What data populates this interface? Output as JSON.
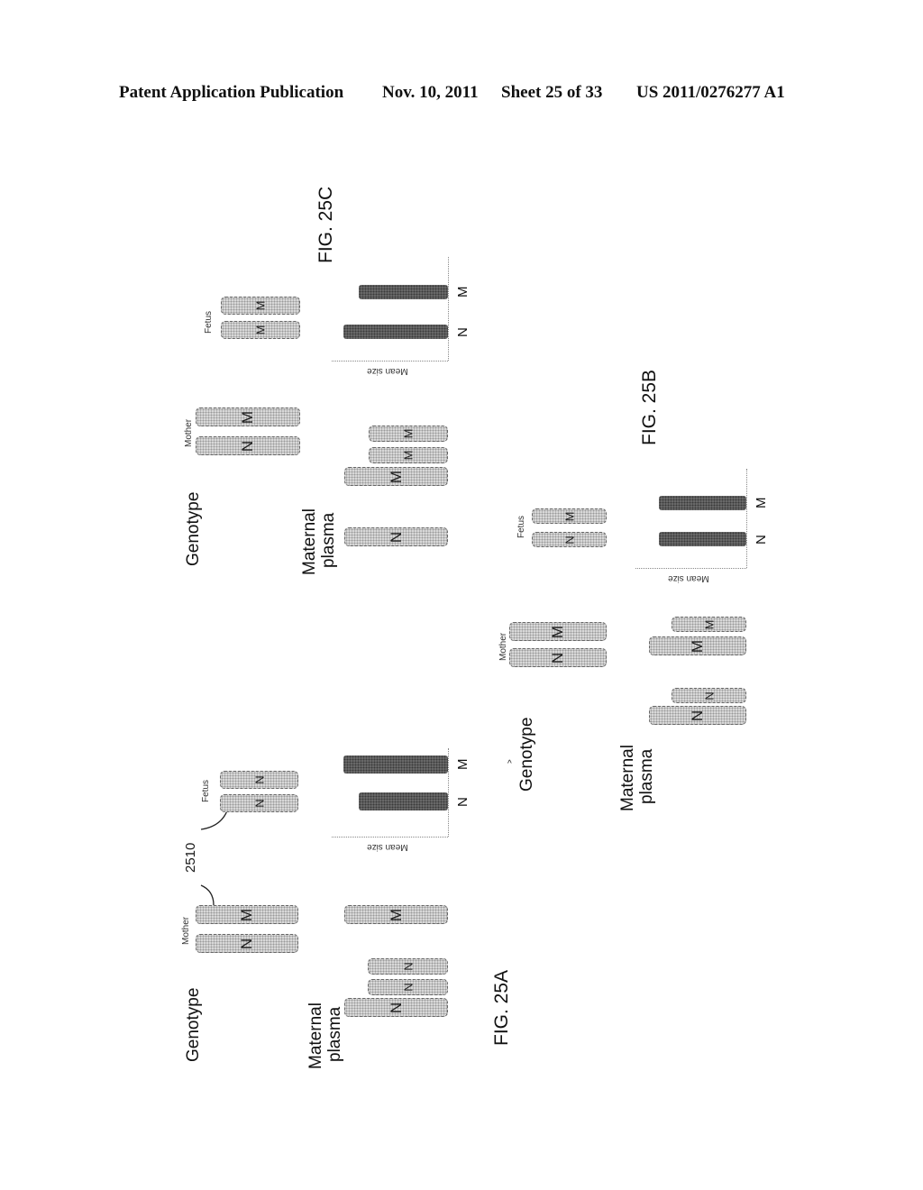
{
  "header": {
    "publication": "Patent Application Publication",
    "date": "Nov. 10, 2011",
    "sheet": "Sheet 25 of 33",
    "number": "US 2011/0276277 A1"
  },
  "figures": {
    "fig25a": {
      "label": "FIG. 25A",
      "genotype_label": "Genotype",
      "plasma_label_1": "Maternal",
      "plasma_label_2": "plasma",
      "mother_label": "Mother",
      "fetus_label": "Fetus",
      "reference_numeral": "2510",
      "mother_alleles": [
        "N",
        "M"
      ],
      "fetus_alleles": [
        "N",
        "N"
      ],
      "plasma_fragments": [
        "N",
        "N",
        "N",
        "M"
      ],
      "axis_label": "Mean size"
    },
    "fig25b": {
      "label": "FIG. 25B",
      "genotype_label": "Genotype",
      "plasma_label_1": "Maternal",
      "plasma_label_2": "plasma",
      "mother_label": "Mother",
      "fetus_label": "Fetus",
      "mother_alleles": [
        "N",
        "M"
      ],
      "fetus_alleles": [
        "N",
        "M"
      ],
      "plasma_fragments": [
        "N",
        "N",
        "M",
        "M"
      ],
      "axis_label": "Mean size"
    },
    "fig25c": {
      "label": "FIG. 25C",
      "genotype_label": "Genotype",
      "plasma_label_1": "Maternal",
      "plasma_label_2": "plasma",
      "mother_label": "Mother",
      "fetus_label": "Fetus",
      "mother_alleles": [
        "N",
        "M"
      ],
      "fetus_alleles": [
        "M",
        "M"
      ],
      "plasma_fragments": [
        "N",
        "M",
        "M",
        "M"
      ],
      "axis_label": "Mean size"
    }
  },
  "chart_data": [
    {
      "type": "bar",
      "title": "FIG. 25A",
      "categories": [
        "N",
        "M"
      ],
      "values": [
        0.85,
        1.0
      ],
      "xlabel": "",
      "ylabel": "Mean size",
      "ylim": [
        0,
        1.1
      ],
      "note": "relative mean size, unlabeled axis"
    },
    {
      "type": "bar",
      "title": "FIG. 25B",
      "categories": [
        "N",
        "M"
      ],
      "values": [
        0.95,
        0.95
      ],
      "xlabel": "",
      "ylabel": "Mean size",
      "ylim": [
        0,
        1.1
      ],
      "note": "relative mean size, unlabeled axis"
    },
    {
      "type": "bar",
      "title": "FIG. 25C",
      "categories": [
        "N",
        "M"
      ],
      "values": [
        1.0,
        0.85
      ],
      "xlabel": "",
      "ylabel": "Mean size",
      "ylim": [
        0,
        1.1
      ],
      "note": "relative mean size, unlabeled axis"
    }
  ]
}
